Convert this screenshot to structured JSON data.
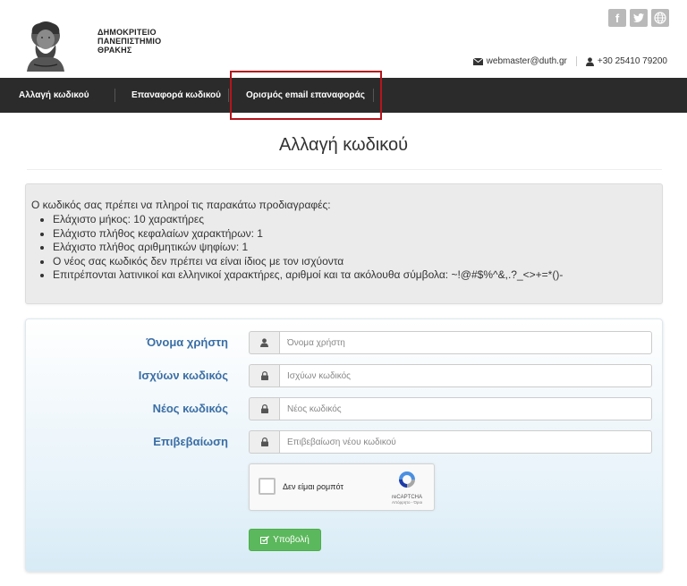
{
  "header": {
    "university_lines": [
      "ΔΗΜΟΚΡΙΤΕΙΟ",
      "ΠΑΝΕΠΙΣΤΗΜΙΟ",
      "ΘΡΑΚΗΣ"
    ],
    "social": [
      {
        "icon": "facebook-icon",
        "glyph": "f"
      },
      {
        "icon": "twitter-icon",
        "glyph": "t"
      },
      {
        "icon": "globe-icon",
        "glyph": "◍"
      }
    ],
    "email": "webmaster@duth.gr",
    "phone": "+30 25410 79200"
  },
  "nav": {
    "items": [
      {
        "label": "Αλλαγή κωδικού"
      },
      {
        "label": "Επαναφορά κωδικού"
      },
      {
        "label": "Ορισμός email επαναφοράς"
      }
    ],
    "highlight_color": "#b3161c"
  },
  "page": {
    "title": "Αλλαγή κωδικού"
  },
  "requirements": {
    "intro": "Ο κωδικός σας πρέπει να πληροί τις παρακάτω προδιαγραφές:",
    "items": [
      "Ελάχιστο μήκος: 10 χαρακτήρες",
      "Ελάχιστο πλήθος κεφαλαίων χαρακτήρων: 1",
      "Ελάχιστο πλήθος αριθμητικών ψηφίων: 1",
      "Ο νέος σας κωδικός δεν πρέπει να είναι ίδιος με τον ισχύοντα",
      "Επιτρέπονται λατινικοί και ελληνικοί χαρακτήρες, αριθμοί και τα ακόλουθα σύμβολα: ~!@#$%^&,.?_<>+=*()-"
    ]
  },
  "form": {
    "fields": [
      {
        "label": "Όνομα χρήστη",
        "placeholder": "Όνομα χρήστη",
        "icon": "user-icon",
        "value": ""
      },
      {
        "label": "Ισχύων κωδικός",
        "placeholder": "Ισχύων κωδικός",
        "icon": "lock-icon",
        "value": ""
      },
      {
        "label": "Νέος κωδικός",
        "placeholder": "Νέος κωδικός",
        "icon": "lock-icon",
        "value": ""
      },
      {
        "label": "Επιβεβαίωση",
        "placeholder": "Επιβεβαίωση νέου κωδικού",
        "icon": "lock-icon",
        "value": ""
      }
    ],
    "captcha": {
      "label": "Δεν είμαι ρομπότ",
      "brand": "reCAPTCHA",
      "terms": "Απόρρητο - Όροι"
    },
    "submit_label": "Υποβολή",
    "label_color": "#3a6ea5",
    "submit_color": "#5cb85c"
  }
}
